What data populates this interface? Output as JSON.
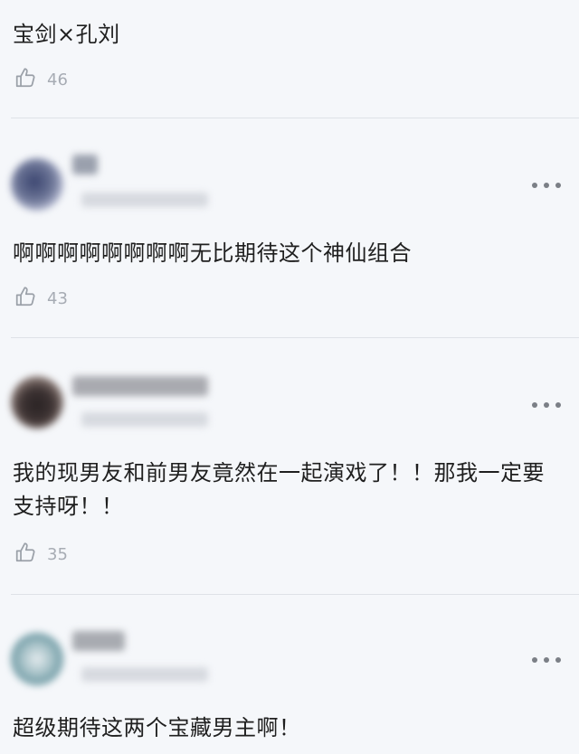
{
  "colors": {
    "background": "#f5f7fa",
    "text": "#1f1f1f",
    "muted": "#a7acb4",
    "divider": "#dfe2e7"
  },
  "comments": [
    {
      "text": "宝剑×孔刘",
      "likes": "46",
      "like_icon": "thumbs-up-icon"
    },
    {
      "text": "啊啊啊啊啊啊啊啊无比期待这个神仙组合",
      "likes": "43",
      "like_icon": "thumbs-up-icon",
      "more_icon": "more-options-icon"
    },
    {
      "text": "我的现男友和前男友竟然在一起演戏了！！那我一定要支持呀！！",
      "likes": "35",
      "like_icon": "thumbs-up-icon",
      "more_icon": "more-options-icon"
    },
    {
      "text": "超级期待这两个宝藏男主啊！",
      "like_icon": "thumbs-up-icon",
      "more_icon": "more-options-icon"
    }
  ]
}
